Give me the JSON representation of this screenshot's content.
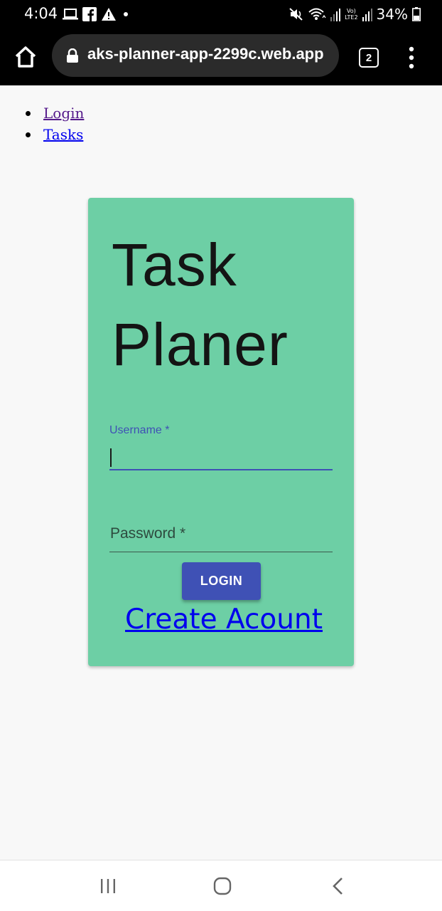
{
  "status_bar": {
    "time": "4:04",
    "left_icons": [
      "laptop-icon",
      "facebook-icon",
      "alert-icon",
      "dot-icon"
    ],
    "right_icons": [
      "mute-icon",
      "wifi-icon",
      "signal-icon",
      "signal-icon"
    ],
    "network_label_top": "Vo)",
    "network_label_bottom": "LTE2",
    "battery_percent": "34%"
  },
  "browser": {
    "url": "aks-planner-app-2299c.web.app",
    "tab_count": "2",
    "icons": [
      "home-icon",
      "lock-icon",
      "tabs-icon",
      "menu-icon"
    ]
  },
  "nav": {
    "items": [
      {
        "label": "Login",
        "visited": true
      },
      {
        "label": "Tasks",
        "visited": false
      }
    ]
  },
  "card": {
    "title": "Task Planer",
    "background": "#6dcfa5",
    "username": {
      "label": "Username *",
      "value": ""
    },
    "password": {
      "label": "Password *",
      "value": ""
    },
    "login_label": "LOGIN",
    "create_account_label": "Create Acount"
  },
  "colors": {
    "primary": "#3f51b5",
    "link": "#0000ee",
    "link_visited": "#551a8b"
  },
  "system_nav": {
    "icons": [
      "recent-apps-icon",
      "home-circle-icon",
      "back-icon"
    ]
  }
}
